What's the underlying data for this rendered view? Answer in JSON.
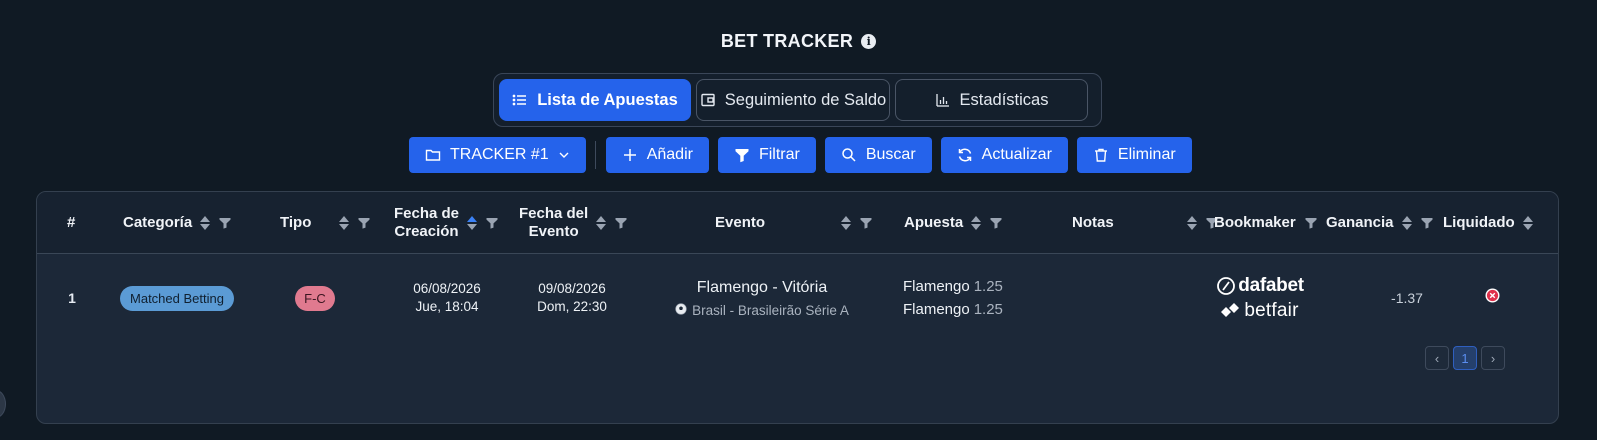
{
  "header": {
    "title": "BET TRACKER",
    "info_icon": "info-icon"
  },
  "tabs": [
    {
      "label": "Lista de Apuestas",
      "icon": "list-icon",
      "active": true
    },
    {
      "label": "Seguimiento de Saldo",
      "icon": "wallet-icon",
      "active": false
    },
    {
      "label": "Estadísticas",
      "icon": "bar-chart-icon",
      "active": false
    }
  ],
  "toolbar": {
    "tracker_label": "TRACKER #1",
    "add_label": "Añadir",
    "filter_label": "Filtrar",
    "search_label": "Buscar",
    "refresh_label": "Actualizar",
    "delete_label": "Eliminar",
    "accent_color": "#2563eb"
  },
  "table": {
    "columns": {
      "index": "#",
      "category": "Categoría",
      "type": "Tipo",
      "created_line1": "Fecha de",
      "created_line2": "Creación",
      "event_date_line1": "Fecha del",
      "event_date_line2": "Evento",
      "event": "Evento",
      "bet": "Apuesta",
      "notes": "Notas",
      "bookmaker": "Bookmaker",
      "profit": "Ganancia",
      "settled": "Liquidado"
    },
    "rows": [
      {
        "index": "1",
        "category": "Matched Betting",
        "type": "F-C",
        "created_date": "06/08/2026",
        "created_time": "Jue, 18:04",
        "event_date": "09/08/2026",
        "event_time": "Dom, 22:30",
        "event_name": "Flamengo - Vitória",
        "event_league": "Brasil - Brasileirão Série A",
        "bet1_team": "Flamengo",
        "bet1_odd": "1.25",
        "bet2_team": "Flamengo",
        "bet2_odd": "1.25",
        "notes": "",
        "bookmaker1": "dafabet",
        "bookmaker2": "betfair",
        "profit": "-1.37",
        "settled_icon": "close-circle-icon"
      }
    ]
  },
  "pagination": {
    "prev": "‹",
    "current": "1",
    "next": "›"
  }
}
